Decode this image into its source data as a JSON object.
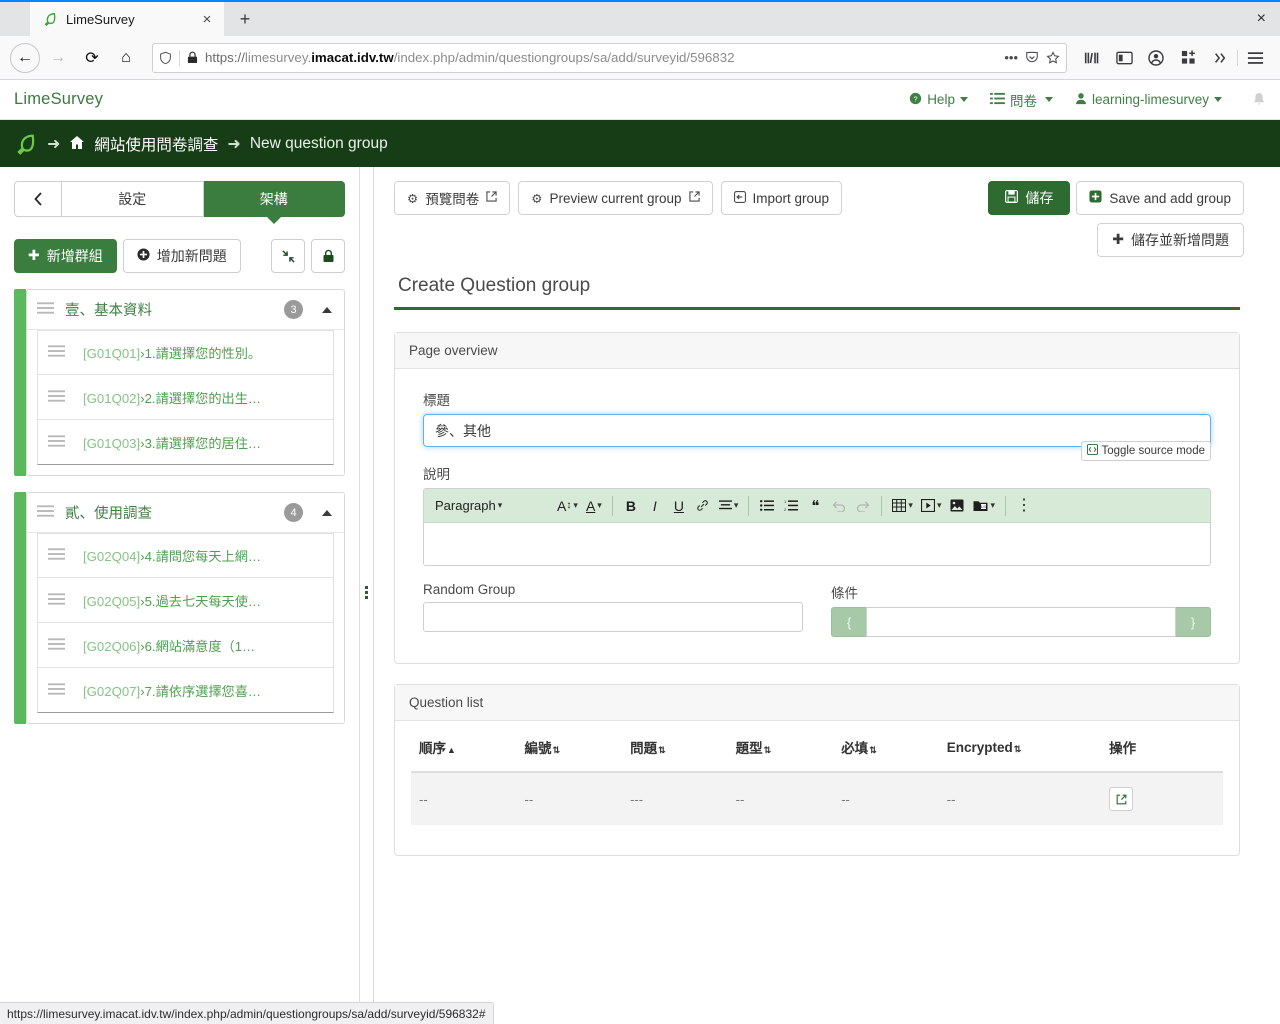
{
  "browser": {
    "tab": {
      "title": "LimeSurvey",
      "favicon_icon": "limesurvey-leaf-icon",
      "close_icon": "×"
    },
    "new_tab_icon": "+",
    "window_close_icon": "×",
    "nav": {
      "back_icon": "←",
      "forward_icon": "→",
      "reload_icon": "⟳",
      "home_icon": "⌂"
    },
    "url": {
      "shield_icon": "shield-icon",
      "lock_icon": "lock-icon",
      "scheme": "https://",
      "host_pre": "limesurvey.",
      "host_bold": "imacat.idv.tw",
      "path": "/index.php/admin/questiongroups/sa/add/surveyid/596832",
      "full": "https://limesurvey.imacat.idv.tw/index.php/admin/questiongroups/sa/add/surveyid/596832",
      "more_icon": "•••",
      "pocket_icon": "pocket-icon",
      "bookmark_icon": "star-icon"
    },
    "toolbar_icons": [
      "library-icon",
      "sidebar-icon",
      "account-icon",
      "extensions-icon",
      "overflow-icon",
      "hamburger-menu-icon"
    ],
    "status_url": "https://limesurvey.imacat.idv.tw/index.php/admin/questiongroups/sa/add/surveyid/596832#"
  },
  "app": {
    "brand": "LimeSurvey",
    "topnav": {
      "help": "Help",
      "help_icon": "question-circle-icon",
      "surveys": "問卷",
      "surveys_icon": "list-icon",
      "user": "learning-limesurvey",
      "user_icon": "user-icon",
      "bell_icon": "bell-icon"
    },
    "breadcrumb": {
      "logo_icon": "limesurvey-leaf-icon",
      "arrow": "➜",
      "home_icon": "home-icon",
      "survey": "網站使用問卷調查",
      "current": "New question group"
    }
  },
  "sidebar": {
    "back_icon": "chevron-left-icon",
    "tabs": [
      {
        "label": "設定",
        "active": false
      },
      {
        "label": "架構",
        "active": true
      }
    ],
    "actions": {
      "add_group": "新增群組",
      "add_group_icon": "plus-icon",
      "add_question": "增加新問題",
      "add_question_icon": "plus-circle-icon",
      "collapse_icon": "collapse-arrows-icon",
      "lock_icon": "lock-icon"
    },
    "groups": [
      {
        "name": "壹、基本資料",
        "count": "3",
        "grip_icon": "drag-handle-icon",
        "collapse_icon": "caret-up-icon",
        "questions": [
          {
            "code": "[G01Q01]",
            "sep": "›",
            "text": "1.請選擇您的性別。"
          },
          {
            "code": "[G01Q02]",
            "sep": "›",
            "text": "2.請選擇您的出生…"
          },
          {
            "code": "[G01Q03]",
            "sep": "›",
            "text": "3.請選擇您的居住…"
          }
        ]
      },
      {
        "name": "貳、使用調查",
        "count": "4",
        "grip_icon": "drag-handle-icon",
        "collapse_icon": "caret-up-icon",
        "questions": [
          {
            "code": "[G02Q04]",
            "sep": "›",
            "text": "4.請問您每天上網…"
          },
          {
            "code": "[G02Q05]",
            "sep": "›",
            "text": "5.過去七天每天使…"
          },
          {
            "code": "[G02Q06]",
            "sep": "›",
            "text": "6.網站滿意度（1…"
          },
          {
            "code": "[G02Q07]",
            "sep": "›",
            "text": "7.請依序選擇您喜…"
          }
        ]
      }
    ]
  },
  "toolbar": {
    "preview_survey": "預覽問卷",
    "preview_survey_icon": "gear-icon",
    "preview_survey_ext_icon": "external-link-icon",
    "preview_group": "Preview current group",
    "preview_group_icon": "gear-icon",
    "preview_group_ext_icon": "external-link-icon",
    "import_group": "Import group",
    "import_group_icon": "import-icon",
    "save": "儲存",
    "save_icon": "floppy-disk-icon",
    "save_and_add_group": "Save and add group",
    "save_and_add_group_icon": "plus-square-icon",
    "save_and_add_question": "儲存並新增問題",
    "save_and_add_question_icon": "plus-icon"
  },
  "main": {
    "page_title": "Create Question group",
    "page_overview": {
      "panel_title": "Page overview",
      "title_label": "標題",
      "title_value": "參、其他",
      "description_label": "說明",
      "toggle_source": "Toggle source mode",
      "toggle_source_icon": "source-code-icon",
      "editor": {
        "paragraph": "Paragraph",
        "items": [
          {
            "icon": "font-size-icon",
            "glyph": "A↕"
          },
          {
            "icon": "font-color-icon",
            "glyph": "A"
          },
          {
            "icon": "bold-icon",
            "glyph": "B"
          },
          {
            "icon": "italic-icon",
            "glyph": "I"
          },
          {
            "icon": "underline-icon",
            "glyph": "U"
          },
          {
            "icon": "link-icon",
            "glyph": "🔗"
          },
          {
            "icon": "align-icon",
            "glyph": "≡"
          },
          {
            "icon": "bullet-list-icon",
            "glyph": "•≡"
          },
          {
            "icon": "numbered-list-icon",
            "glyph": "1≡"
          },
          {
            "icon": "blockquote-icon",
            "glyph": "❝"
          },
          {
            "icon": "undo-icon",
            "glyph": "↶"
          },
          {
            "icon": "redo-icon",
            "glyph": "↷"
          },
          {
            "icon": "table-icon",
            "glyph": "▦"
          },
          {
            "icon": "media-icon",
            "glyph": "▶"
          },
          {
            "icon": "image-icon",
            "glyph": "🖼"
          },
          {
            "icon": "file-manager-icon",
            "glyph": "🗂"
          },
          {
            "icon": "more-options-icon",
            "glyph": "⋮"
          }
        ],
        "content": ""
      },
      "random_group_label": "Random Group",
      "random_group_value": "",
      "condition_label": "條件",
      "condition_prefix": "{",
      "condition_suffix": "}",
      "condition_value": ""
    },
    "question_list": {
      "panel_title": "Question list",
      "columns": [
        {
          "label": "順序",
          "sort": "▲"
        },
        {
          "label": "編號",
          "sort": "⇅"
        },
        {
          "label": "問題",
          "sort": "⇅"
        },
        {
          "label": "題型",
          "sort": "⇅"
        },
        {
          "label": "必填",
          "sort": "⇅"
        },
        {
          "label": "Encrypted",
          "sort": "⇅"
        },
        {
          "label": "操作",
          "sort": ""
        }
      ],
      "rows": [
        {
          "cells": [
            "--",
            "--",
            "---",
            "--",
            "--",
            "--"
          ],
          "action_icon": "external-link-icon"
        }
      ]
    }
  }
}
